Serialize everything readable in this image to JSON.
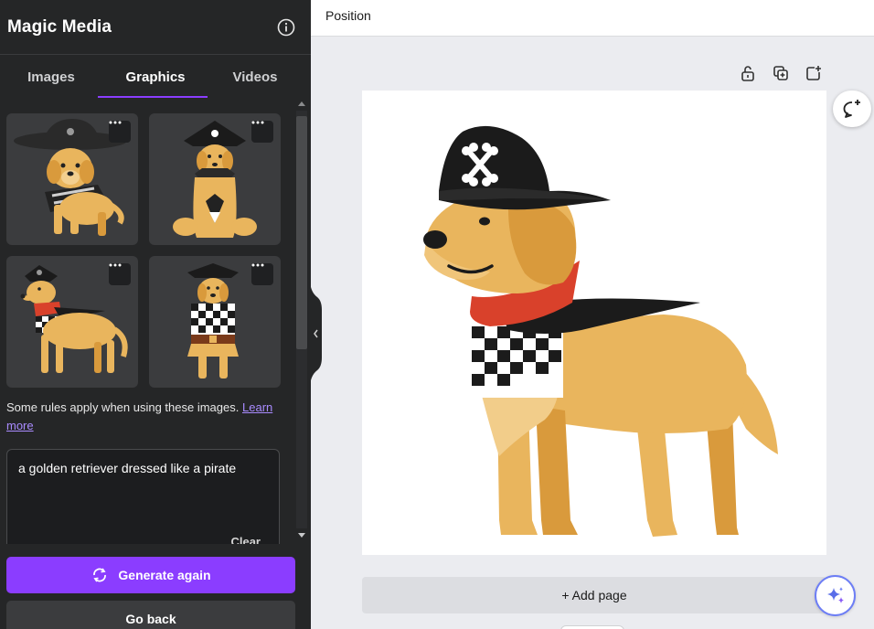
{
  "panel": {
    "title": "Magic Media",
    "info_icon": "info-icon",
    "tabs": [
      {
        "label": "Images",
        "active": false
      },
      {
        "label": "Graphics",
        "active": true
      },
      {
        "label": "Videos",
        "active": false
      }
    ],
    "thumbnails": [
      {
        "subject": "golden-retriever-pirate-1"
      },
      {
        "subject": "golden-retriever-pirate-2"
      },
      {
        "subject": "golden-retriever-pirate-3"
      },
      {
        "subject": "golden-retriever-pirate-4"
      }
    ],
    "rules_text": "Some rules apply when using these images.",
    "rules_link": "Learn more",
    "prompt_value": "a golden retriever dressed like a pirate",
    "clear_label": "Clear",
    "generate_label": "Generate again",
    "go_back_label": "Go back"
  },
  "editor": {
    "position_label": "Position",
    "add_page_label": "+ Add page",
    "toolbar_icons": [
      "lock-icon",
      "duplicate-icon",
      "add-page-icon"
    ],
    "comment_icon": "comment-icon",
    "magic_icon": "sparkle-icon"
  },
  "colors": {
    "accent": "#8b3dff",
    "panel_bg": "#252627",
    "canvas_bg": "#ebecf0",
    "dog_gold": "#e9b55d",
    "bandana_red": "#d9412b",
    "hat_black": "#1b1b1b"
  }
}
